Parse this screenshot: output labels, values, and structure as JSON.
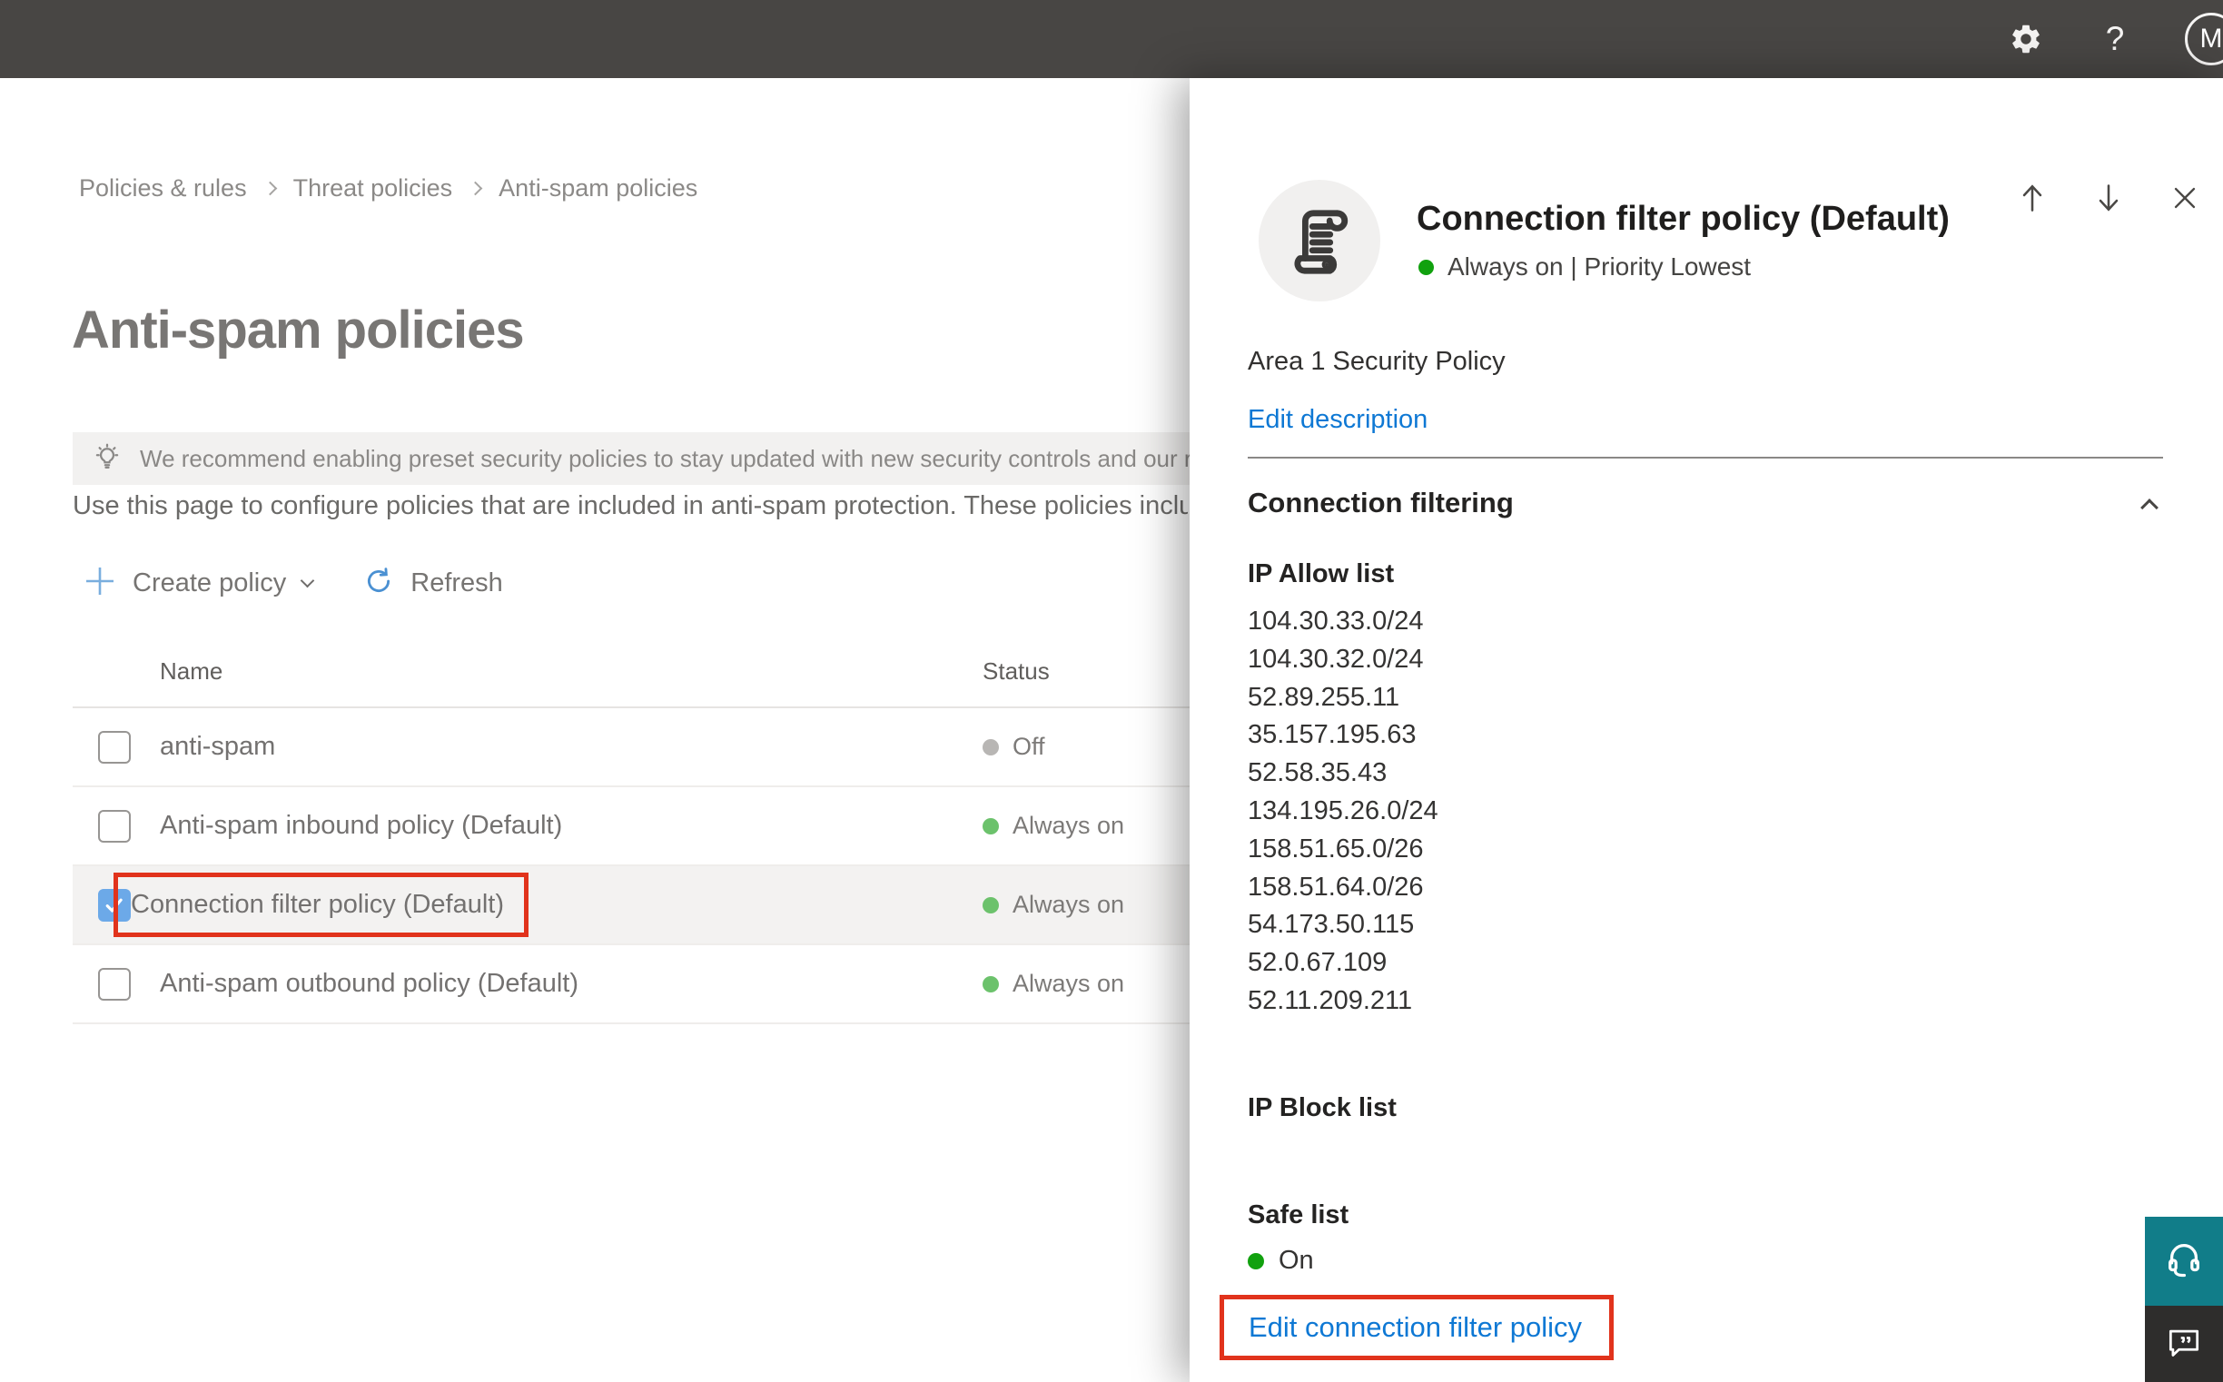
{
  "topbar": {
    "avatar_initial": "M"
  },
  "breadcrumb": {
    "items": [
      "Policies & rules",
      "Threat policies",
      "Anti-spam policies"
    ]
  },
  "page": {
    "title": "Anti-spam policies",
    "banner_text": "We recommend enabling preset security policies to stay updated with new security controls and our recomme",
    "description": "Use this page to configure policies that are included in anti-spam protection. These policies include",
    "toolbar": {
      "create_label": "Create policy",
      "refresh_label": "Refresh"
    }
  },
  "table": {
    "columns": {
      "name": "Name",
      "status": "Status"
    },
    "rows": [
      {
        "name": "anti-spam",
        "status": "Off",
        "status_color": "gray",
        "checked": false,
        "selected": false
      },
      {
        "name": "Anti-spam inbound policy (Default)",
        "status": "Always on",
        "status_color": "green",
        "checked": false,
        "selected": false
      },
      {
        "name": "Connection filter policy (Default)",
        "status": "Always on",
        "status_color": "green",
        "checked": true,
        "selected": true,
        "name_highlighted_red": true
      },
      {
        "name": "Anti-spam outbound policy (Default)",
        "status": "Always on",
        "status_color": "green",
        "checked": false,
        "selected": false
      }
    ]
  },
  "flyout": {
    "title": "Connection filter policy (Default)",
    "status_line": "Always on | Priority Lowest",
    "description": "Area 1 Security Policy",
    "edit_description_label": "Edit description",
    "connection_filtering": {
      "heading": "Connection filtering",
      "ip_allow": {
        "heading": "IP Allow list",
        "items": [
          "104.30.33.0/24",
          "104.30.32.0/24",
          "52.89.255.11",
          "35.157.195.63",
          "52.58.35.43",
          "134.195.26.0/24",
          "158.51.65.0/26",
          "158.51.64.0/26",
          "54.173.50.115",
          "52.0.67.109",
          "52.11.209.211"
        ]
      },
      "ip_block": {
        "heading": "IP Block list"
      },
      "safe_list": {
        "heading": "Safe list",
        "status": "On"
      },
      "edit_link_label": "Edit connection filter policy"
    }
  },
  "colors": {
    "topbar": "#484644",
    "accent_blue": "#0e78d4",
    "highlight_red": "#e1331c",
    "checkbox_blue": "#6ca9e8",
    "status_green": "#6cc26c",
    "status_green_vivid": "#11a10e",
    "status_gray": "#b8b6b4",
    "support_teal": "#117d89"
  }
}
